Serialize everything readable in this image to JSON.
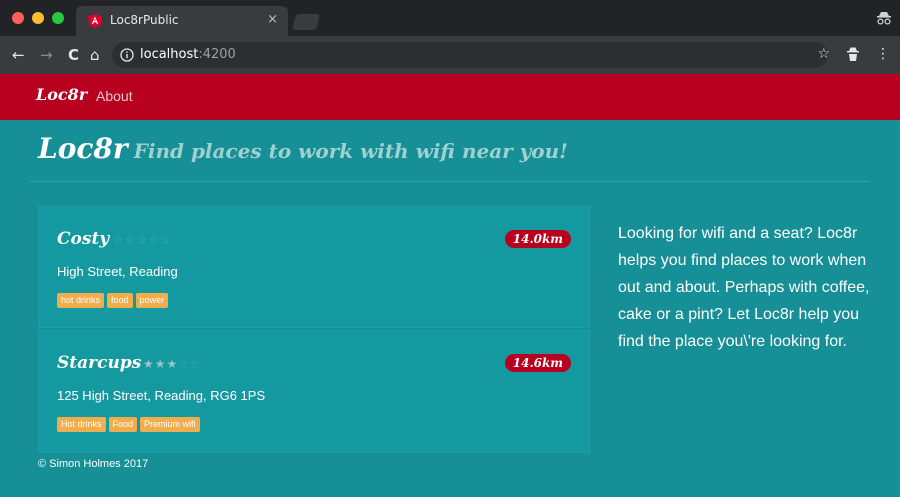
{
  "browser": {
    "tab_title": "Loc8rPublic",
    "tab_close": "×",
    "url_host": "localhost",
    "url_port": ":4200",
    "nav": {
      "back": "←",
      "forward": "→",
      "reload": "C",
      "home": "⌂"
    },
    "right": {
      "star": "☆",
      "menu": "⋮"
    }
  },
  "navbar": {
    "brand": "Loc8r",
    "about": "About"
  },
  "header": {
    "title": "Loc8r",
    "tagline": "Find places to work with wifi near you!"
  },
  "locations": [
    {
      "name": "Costy",
      "rating": 0,
      "distance": "14.0km",
      "address": "High Street, Reading",
      "facilities": [
        "hot drinks",
        "food",
        "power"
      ]
    },
    {
      "name": "Starcups",
      "rating": 3,
      "distance": "14.6km",
      "address": "125 High Street, Reading, RG6 1PS",
      "facilities": [
        "Hot drinks",
        "Food",
        "Premium wifi"
      ]
    }
  ],
  "sidebar": {
    "text": "Looking for wifi and a seat? Loc8r helps you find places to work when out and about. Perhaps with coffee, cake or a pint? Let Loc8r help you find the place you\\'re looking for."
  },
  "footer": {
    "text": "© Simon Holmes 2017"
  },
  "colors": {
    "navbar": "#b8001f",
    "page_background": "#168f96",
    "card_background": "#1599a1",
    "badge_distance": "#b8001f",
    "facility_label": "#f0ad4e"
  },
  "icons": {
    "favicon": "angular-icon",
    "site_info": "info-icon",
    "profile": "incognito-icon",
    "bookmark": "star-icon",
    "menu": "kebab-icon"
  }
}
